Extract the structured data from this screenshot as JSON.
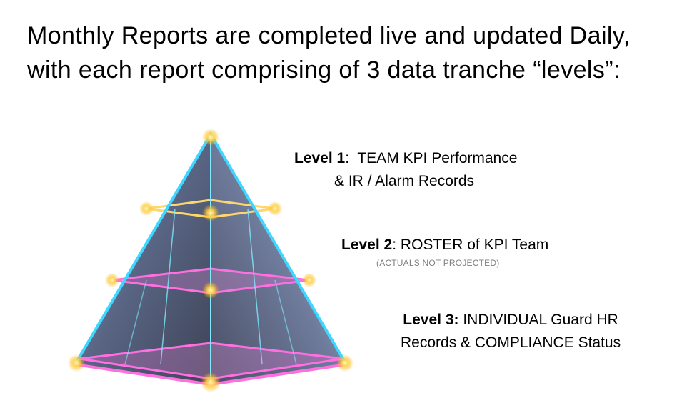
{
  "title": {
    "line1": "Monthly Reports are completed live and updated Daily,",
    "line2": "with each report comprising of 3 data tranche “levels”:"
  },
  "levels": [
    {
      "label": "Level 1",
      "separator": ":",
      "text_line1": "  TEAM KPI Performance",
      "text_line2": "& IR / Alarm Records"
    },
    {
      "label": "Level 2",
      "separator": ":",
      "text_line1": " ROSTER of KPI Team",
      "note": "(ACTUALS NOT PROJECTED)"
    },
    {
      "label": "Level 3:",
      "text_line1": " INDIVIDUAL Guard HR",
      "text_line2": "Records & COMPLIANCE Status"
    }
  ],
  "colors": {
    "edge_cyan": "#3fd6ff",
    "edge_magenta": "#ff4fd8",
    "glow_yellow": "#ffe27a",
    "glass_dark": "#2b3550"
  }
}
